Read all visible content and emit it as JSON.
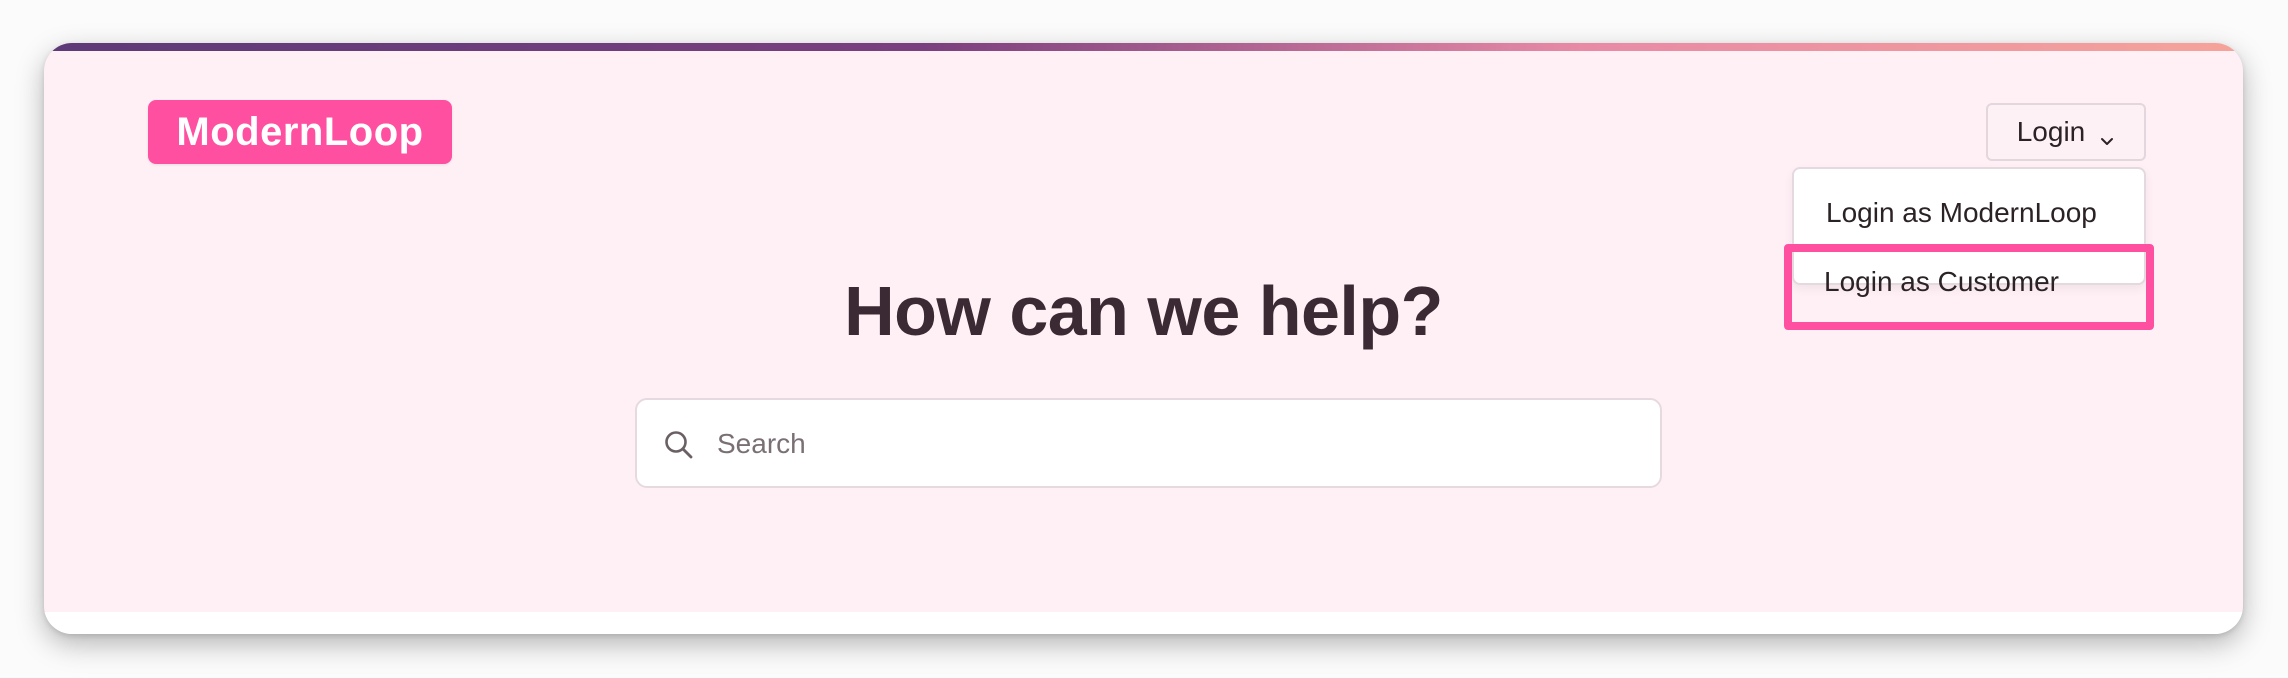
{
  "brand": {
    "logo_text": "ModernLoop",
    "accent_color": "#ff4fa0"
  },
  "header": {
    "login_label": "Login",
    "login_icon": "chevron-down-icon"
  },
  "login_menu": {
    "items": [
      {
        "label": "Login as ModernLoop"
      },
      {
        "label": "Login as Customer",
        "highlighted": true
      }
    ]
  },
  "hero": {
    "title": "How can we help?"
  },
  "search": {
    "placeholder": "Search",
    "value": "",
    "icon": "search-icon"
  }
}
